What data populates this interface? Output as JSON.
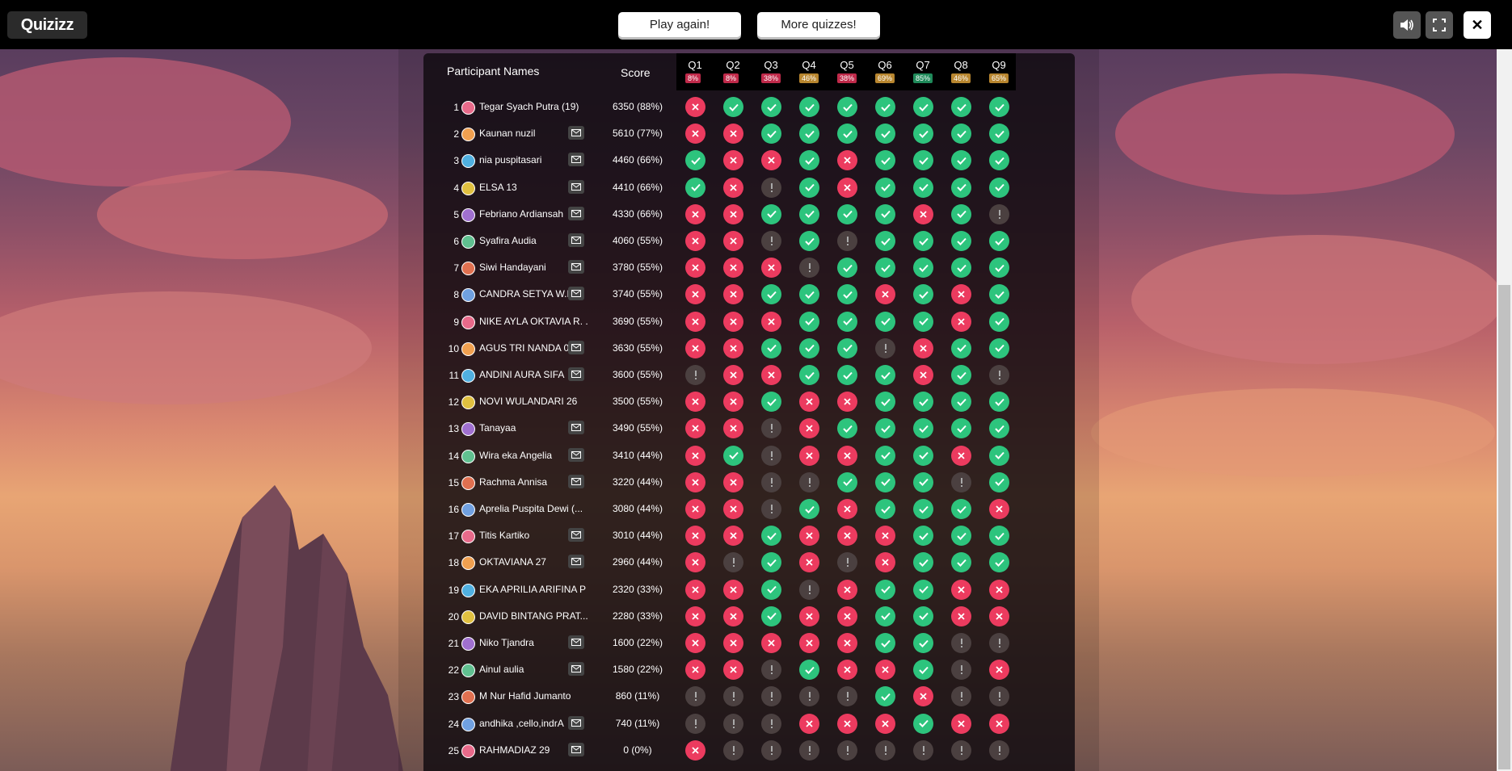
{
  "topbar": {
    "logo_text": "Quizizz",
    "play_again_label": "Play again!",
    "more_quizzes_label": "More quizzes!",
    "close_glyph": "✕"
  },
  "table": {
    "header_names": "Participant Names",
    "header_score": "Score",
    "questions": [
      {
        "label": "Q1",
        "percent": "8%",
        "color": "#c02a4a"
      },
      {
        "label": "Q2",
        "percent": "8%",
        "color": "#c02a4a"
      },
      {
        "label": "Q3",
        "percent": "38%",
        "color": "#c02a4a"
      },
      {
        "label": "Q4",
        "percent": "46%",
        "color": "#b8862f"
      },
      {
        "label": "Q5",
        "percent": "38%",
        "color": "#c02a4a"
      },
      {
        "label": "Q6",
        "percent": "69%",
        "color": "#b8862f"
      },
      {
        "label": "Q7",
        "percent": "85%",
        "color": "#1f8a5a"
      },
      {
        "label": "Q8",
        "percent": "46%",
        "color": "#b8862f"
      },
      {
        "label": "Q9",
        "percent": "65%",
        "color": "#b8862f"
      }
    ],
    "rows": [
      {
        "rank": "1",
        "name": "Tegar Syach Putra (19)",
        "mail": false,
        "score": "6350 (88%)",
        "marks": "wcccccccc"
      },
      {
        "rank": "2",
        "name": "Kaunan nuzil",
        "mail": true,
        "score": "5610 (77%)",
        "marks": "wwccccccc"
      },
      {
        "rank": "3",
        "name": "nia puspitasari",
        "mail": true,
        "score": "4460 (66%)",
        "marks": "cwwcwcccc"
      },
      {
        "rank": "4",
        "name": "ELSA 13",
        "mail": true,
        "score": "4410 (66%)",
        "marks": "cwucwcccc"
      },
      {
        "rank": "5",
        "name": "Febriano Ardiansah",
        "mail": true,
        "score": "4330 (66%)",
        "marks": "wwccccwc"
      },
      {
        "rank": "6",
        "name": "Syafira Audia",
        "mail": true,
        "score": "4060 (55%)",
        "marks": "wwucucccc"
      },
      {
        "rank": "7",
        "name": "Siwi Handayani",
        "mail": true,
        "score": "3780 (55%)",
        "marks": "wwwucccccc"
      },
      {
        "rank": "8",
        "name": "CANDRA SETYA W.P",
        "mail": true,
        "score": "3740 (55%)",
        "marks": "wwcccwcwc"
      },
      {
        "rank": "9",
        "name": "NIKE AYLA OKTAVIA R. ...",
        "mail": false,
        "score": "3690 (55%)",
        "marks": "wwwccccwc"
      },
      {
        "rank": "10",
        "name": "AGUS TRI NANDA 01",
        "mail": true,
        "score": "3630 (55%)",
        "marks": "wwcccuwcc"
      },
      {
        "rank": "11",
        "name": "ANDINI AURA SIFA",
        "mail": true,
        "score": "3600 (55%)",
        "marks": "uwwcccwc"
      },
      {
        "rank": "12",
        "name": "NOVI WULANDARI 26",
        "mail": false,
        "score": "3500 (55%)",
        "marks": "wwcwwcccc"
      },
      {
        "rank": "13",
        "name": "Tanayaa",
        "mail": true,
        "score": "3490 (55%)",
        "marks": "wwuwccccc"
      },
      {
        "rank": "14",
        "name": "Wira eka Angelia",
        "mail": true,
        "score": "3410 (44%)",
        "marks": "wcuwwccwc"
      },
      {
        "rank": "15",
        "name": "Rachma Annisa",
        "mail": true,
        "score": "3220 (44%)",
        "marks": "wwuuccc uc"
      },
      {
        "rank": "16",
        "name": "Aprelia Puspita Dewi (...",
        "mail": false,
        "score": "3080 (44%)",
        "marks": "wwucwcccw"
      },
      {
        "rank": "17",
        "name": "Titis Kartiko",
        "mail": true,
        "score": "3010 (44%)",
        "marks": "wwcwwwccc"
      },
      {
        "rank": "18",
        "name": "OKTAVIANA 27",
        "mail": true,
        "score": "2960 (44%)",
        "marks": "wucwuwccc"
      },
      {
        "rank": "19",
        "name": "EKA APRILIA ARIFINA P",
        "mail": false,
        "score": "2320 (33%)",
        "marks": "wwcuwccww"
      },
      {
        "rank": "20",
        "name": "DAVID BINTANG PRAT...",
        "mail": false,
        "score": "2280 (33%)",
        "marks": "wwcwwccww"
      },
      {
        "rank": "21",
        "name": "Niko Tjandra",
        "mail": true,
        "score": "1600 (22%)",
        "marks": "wwwwwccuu"
      },
      {
        "rank": "22",
        "name": "Ainul aulia",
        "mail": true,
        "score": "1580 (22%)",
        "marks": "wwucwwcuw"
      },
      {
        "rank": "23",
        "name": "M Nur Hafid Jumanto",
        "mail": false,
        "score": "860 (11%)",
        "marks": "uuuuucwuu"
      },
      {
        "rank": "24",
        "name": "andhika ,cello,indrA",
        "mail": true,
        "score": "740 (11%)",
        "marks": "uuuwwwcww"
      },
      {
        "rank": "25",
        "name": "RAHMADIAZ 29",
        "mail": true,
        "score": "0 (0%)",
        "marks": "wuuuuuuuu"
      }
    ]
  },
  "colors": {
    "correct": "#2dc47d",
    "wrong": "#ec3b5f",
    "unanswered": "#4b4040"
  }
}
